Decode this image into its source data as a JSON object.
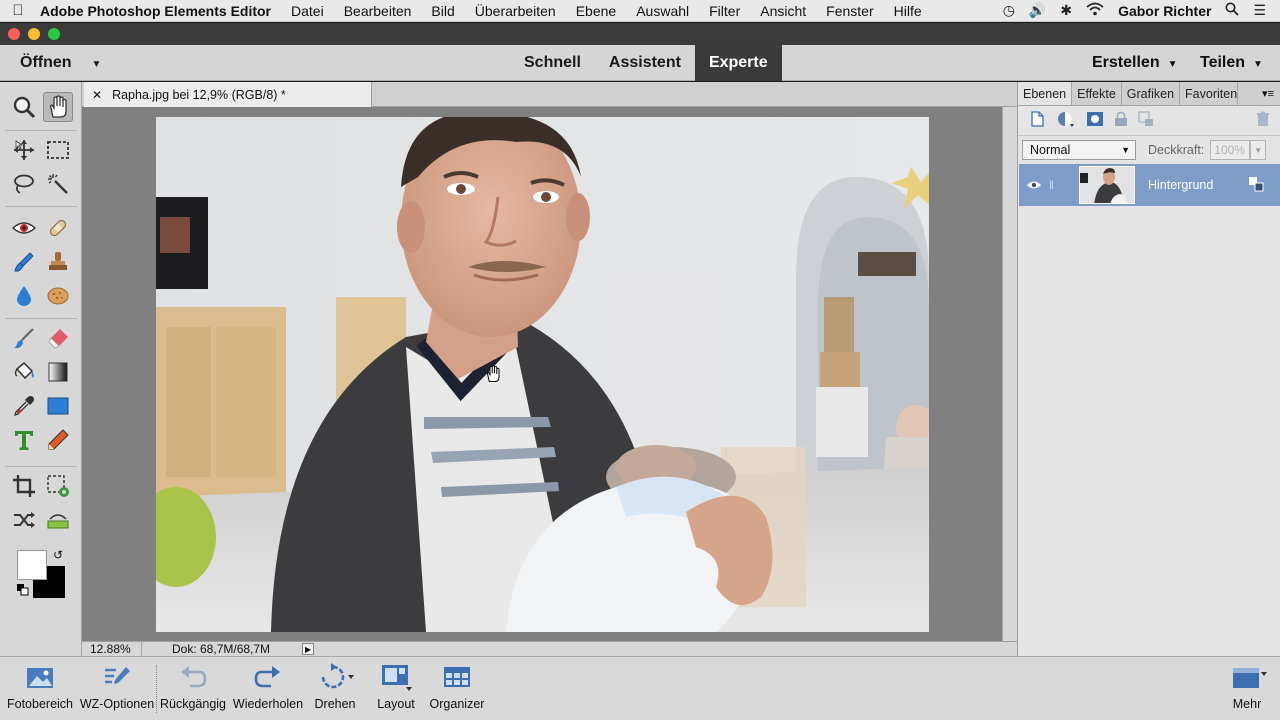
{
  "menubar": {
    "app_name": "Adobe Photoshop Elements Editor",
    "items": [
      "Datei",
      "Bearbeiten",
      "Bild",
      "Überarbeiten",
      "Ebene",
      "Auswahl",
      "Filter",
      "Ansicht",
      "Fenster",
      "Hilfe"
    ],
    "user": "Gabor Richter"
  },
  "topbar": {
    "open_label": "Öffnen",
    "modes": [
      "Schnell",
      "Assistent",
      "Experte"
    ],
    "active_mode": "Experte",
    "create_label": "Erstellen",
    "share_label": "Teilen"
  },
  "document": {
    "tab_title": "Rapha.jpg bei 12,9% (RGB/8) *",
    "zoom": "12.88%",
    "doc_size": "Dok: 68,7M/68,7M"
  },
  "layers_panel": {
    "tabs": [
      "Ebenen",
      "Effekte",
      "Grafiken",
      "Favoriten"
    ],
    "active_tab": "Ebenen",
    "blend_mode": "Normal",
    "opacity_label": "Deckkraft:",
    "opacity_value": "100%",
    "layers": [
      {
        "name": "Hintergrund",
        "visible": true,
        "selected": true
      }
    ]
  },
  "taskbar": {
    "items": [
      "Fotobereich",
      "WZ-Optionen",
      "Rückgängig",
      "Wiederholen",
      "Drehen",
      "Layout",
      "Organizer"
    ],
    "more_label": "Mehr"
  },
  "colors": {
    "selected_layer": "#7f9bc8",
    "active_mode_bg": "#3a3a3a",
    "tool_blue": "#2d7fd6"
  }
}
